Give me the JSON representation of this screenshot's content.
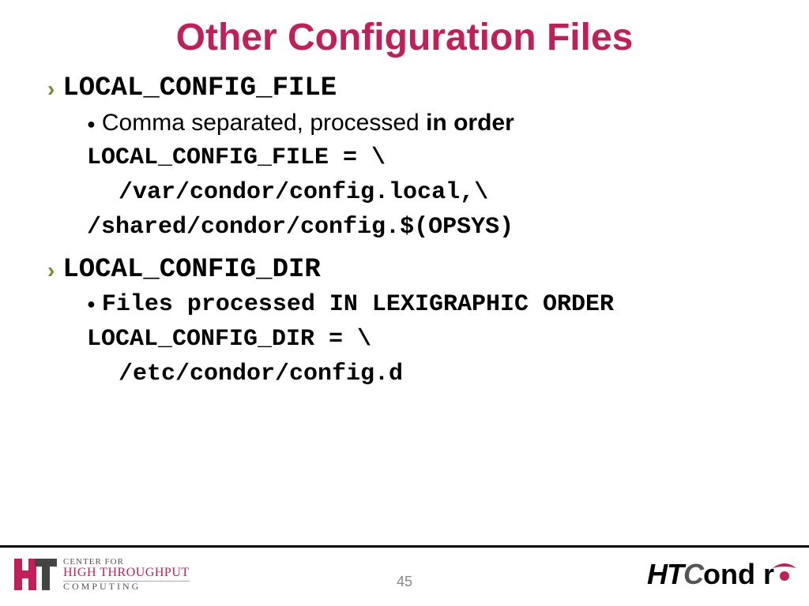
{
  "title": "Other Configuration Files",
  "section1": {
    "header": "LOCAL_CONFIG_FILE",
    "desc_plain": "Comma separated, processed ",
    "desc_bold": "in order",
    "code1": "LOCAL_CONFIG_FILE = \\",
    "code2": "/var/condor/config.local,\\",
    "code3": "/shared/condor/config.$(OPSYS)"
  },
  "section2": {
    "header": "LOCAL_CONFIG_DIR",
    "desc": "Files processed IN LEXIGRAPHIC ORDER",
    "code1": "LOCAL_CONFIG_DIR = \\",
    "code2": "/etc/condor/config.d"
  },
  "footer": {
    "chtc_line1": "CENTER FOR",
    "chtc_line2": "HIGH THROUGHPUT",
    "chtc_line3": "COMPUTING",
    "page": "45",
    "logo_ht": "HT",
    "logo_c": "C",
    "logo_rest": "ond   r"
  }
}
